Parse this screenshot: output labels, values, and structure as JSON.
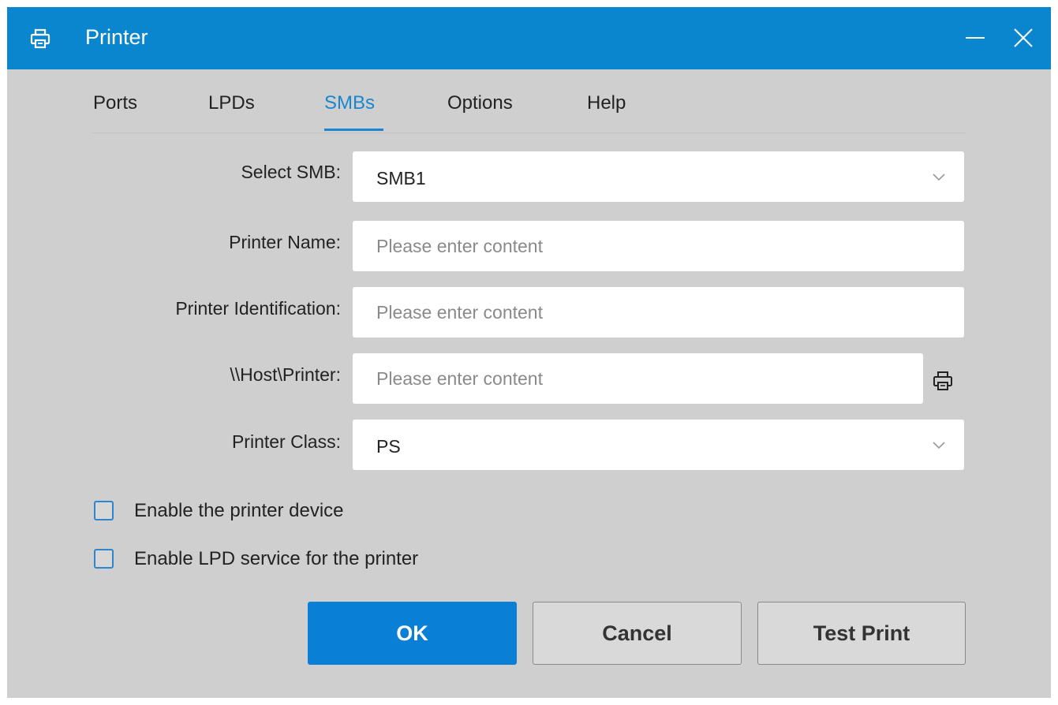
{
  "window": {
    "title": "Printer",
    "title_icon": "printer-icon",
    "minimize_icon": "minimize-icon",
    "close_icon": "close-icon",
    "accent_color": "#0a86cf"
  },
  "tabs": [
    {
      "label": "Ports",
      "active": false
    },
    {
      "label": "LPDs",
      "active": false
    },
    {
      "label": "SMBs",
      "active": true
    },
    {
      "label": "Options",
      "active": false
    },
    {
      "label": "Help",
      "active": false
    }
  ],
  "form": {
    "select_smb": {
      "label": "Select SMB:",
      "value": "SMB1"
    },
    "printer_name": {
      "label": "Printer Name:",
      "value": "",
      "placeholder": "Please enter content"
    },
    "printer_identification": {
      "label": "Printer Identification:",
      "value": "",
      "placeholder": "Please enter content"
    },
    "host_printer": {
      "label": "\\\\Host\\Printer:",
      "value": "",
      "placeholder": "Please enter content",
      "icon": "printer-icon"
    },
    "printer_class": {
      "label": "Printer Class:",
      "value": "PS"
    }
  },
  "checkboxes": [
    {
      "label": "Enable the printer device",
      "checked": false
    },
    {
      "label": "Enable LPD service for the printer",
      "checked": false
    }
  ],
  "buttons": {
    "ok": "OK",
    "cancel": "Cancel",
    "test_print": "Test Print"
  }
}
